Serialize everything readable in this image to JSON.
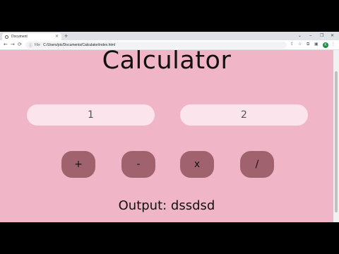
{
  "browser": {
    "tab_title": "Document",
    "tab_close": "×",
    "new_tab": "+",
    "window_controls": {
      "chevron": "⌄",
      "minimize": "–",
      "maximize": "❐",
      "close": "✕"
    },
    "nav": {
      "back": "←",
      "forward": "→",
      "reload": "⟳"
    },
    "address": {
      "lock": "ⓘ",
      "scheme": "File",
      "url": "C:/Users/pic/Documents/Calculator/index.html"
    },
    "toolbar_icons": {
      "share": "⇪",
      "star": "☆",
      "extension": "⧉",
      "sidebar": "▣"
    },
    "profile_initial": "K",
    "menu": "⋮"
  },
  "page": {
    "heading": "Calculator",
    "inputs": {
      "first_value": "1",
      "second_value": "2"
    },
    "operators": {
      "add": "+",
      "subtract": "-",
      "multiply": "x",
      "divide": "/"
    },
    "output": "Output: dssdsd"
  },
  "colors": {
    "page_background": "#f0b6c8",
    "input_background": "#fce4ec",
    "button_background": "#a0636e",
    "text": "#111111"
  }
}
